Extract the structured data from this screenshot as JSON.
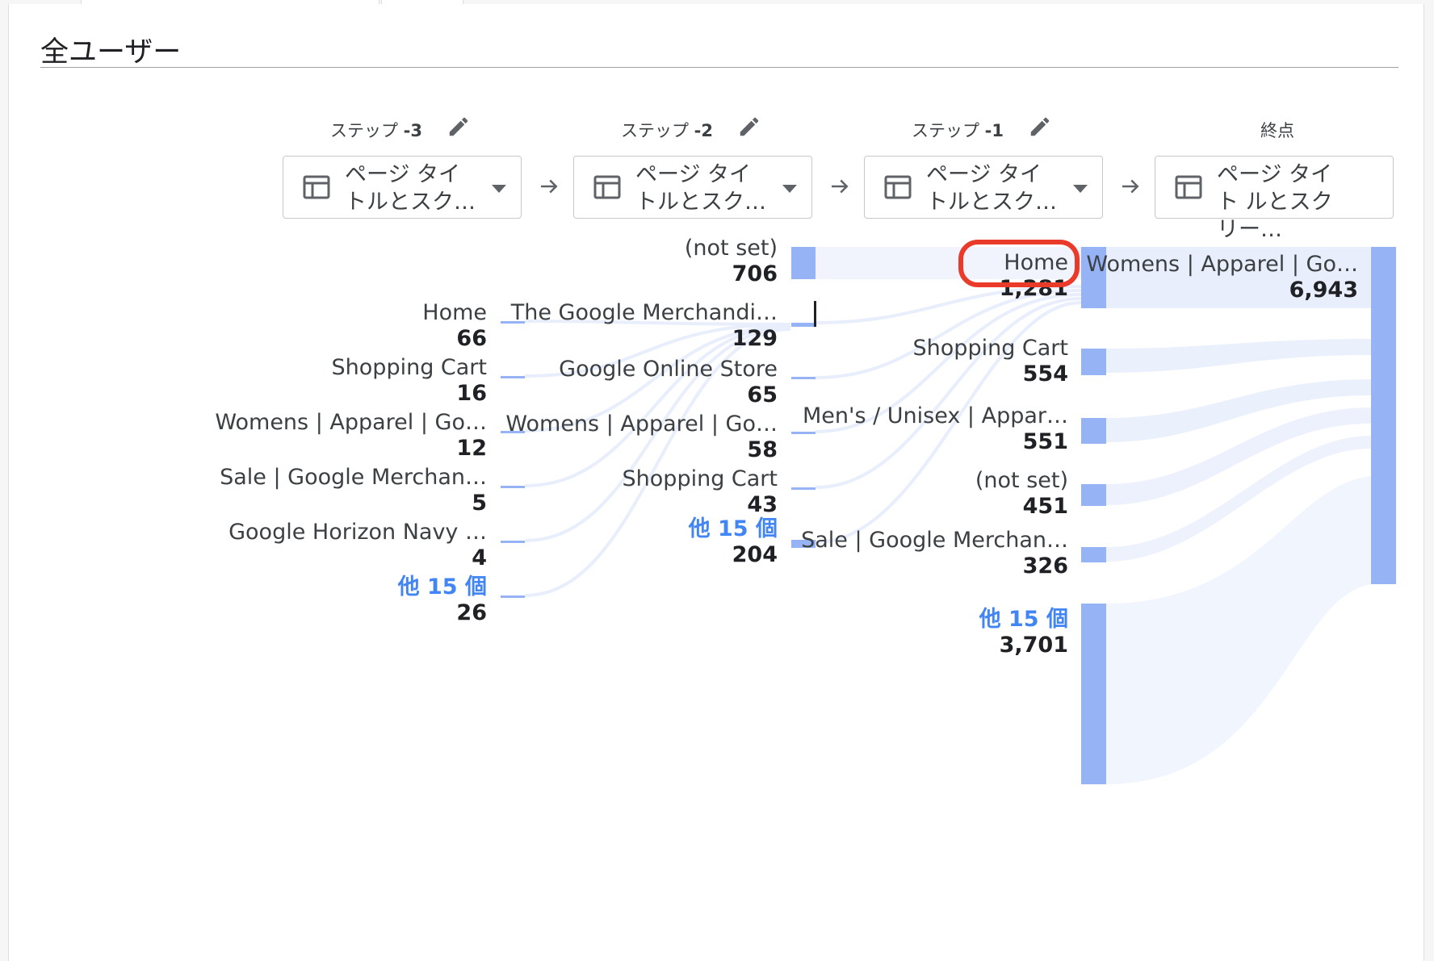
{
  "report": {
    "segment_title": "全ユーザー"
  },
  "steps": [
    {
      "label": "ステップ",
      "number": "-3",
      "dropdown_text": "ページ タイ トルとスク…",
      "editable": true
    },
    {
      "label": "ステップ",
      "number": "-2",
      "dropdown_text": "ページ タイ トルとスク…",
      "editable": true
    },
    {
      "label": "ステップ",
      "number": "-1",
      "dropdown_text": "ページ タイ トルとスク…",
      "editable": true
    },
    {
      "label": "終点",
      "number": "",
      "dropdown_text": "ページ タイト ルとスクリー…",
      "editable": false
    }
  ],
  "icons": {
    "edit": "pencil-icon",
    "dimension": "table-icon",
    "dropdown": "caret-down-icon",
    "step_arrow": "arrow-right-icon"
  },
  "columns": {
    "step_minus_3": [
      {
        "label": "Home",
        "value": "66",
        "is_more": false
      },
      {
        "label": "Shopping Cart",
        "value": "16",
        "is_more": false
      },
      {
        "label": "Womens | Apparel | Go…",
        "value": "12",
        "is_more": false
      },
      {
        "label": "Sale | Google Merchan…",
        "value": "5",
        "is_more": false
      },
      {
        "label": "Google Horizon Navy …",
        "value": "4",
        "is_more": false
      },
      {
        "label": "他 15 個",
        "value": "26",
        "is_more": true
      }
    ],
    "step_minus_2": [
      {
        "label": "(not set)",
        "value": "706",
        "is_more": false
      },
      {
        "label": "The Google Merchandi…",
        "value": "129",
        "is_more": false
      },
      {
        "label": "Google Online Store",
        "value": "65",
        "is_more": false
      },
      {
        "label": "Womens | Apparel | Go…",
        "value": "58",
        "is_more": false
      },
      {
        "label": "Shopping Cart",
        "value": "43",
        "is_more": false
      },
      {
        "label": "他 15 個",
        "value": "204",
        "is_more": true
      }
    ],
    "step_minus_1": [
      {
        "label": "Home",
        "value": "1,281",
        "is_more": false
      },
      {
        "label": "Shopping Cart",
        "value": "554",
        "is_more": false
      },
      {
        "label": "Men's / Unisex | Appar…",
        "value": "551",
        "is_more": false
      },
      {
        "label": "(not set)",
        "value": "451",
        "is_more": false
      },
      {
        "label": "Sale | Google Merchan…",
        "value": "326",
        "is_more": false
      },
      {
        "label": "他 15 個",
        "value": "3,701",
        "is_more": true
      }
    ],
    "end_point": [
      {
        "label": "Womens | Apparel | Go…",
        "value": "6,943",
        "is_more": false
      }
    ]
  },
  "colors": {
    "node": "#96b4f5",
    "link": "#e8eefc",
    "more_link": "#4285f4",
    "highlight": "#ea3b2a"
  }
}
